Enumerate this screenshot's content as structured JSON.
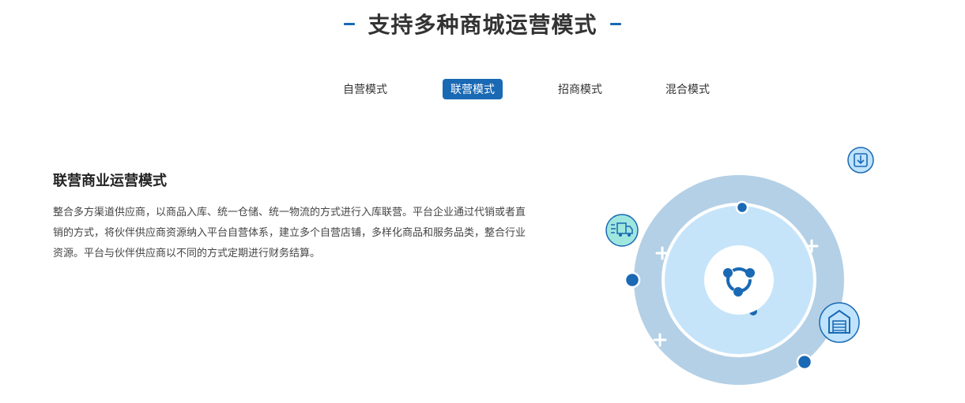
{
  "header": {
    "title": "支持多种商城运营模式"
  },
  "tabs": [
    {
      "label": "自营模式",
      "active": false
    },
    {
      "label": "联营模式",
      "active": true
    },
    {
      "label": "招商模式",
      "active": false
    },
    {
      "label": "混合模式",
      "active": false
    }
  ],
  "content": {
    "heading": "联营商业运营模式",
    "description": "整合多方渠道供应商，以商品入库、统一仓储、统一物流的方式进行入库联营。平台企业通过代销或者直销的方式，将伙伴供应商资源纳入平台自营体系，建立多个自营店铺，多样化商品和服务品类，整合行业资源。平台与伙伴供应商以不同的方式定期进行财务结算。"
  },
  "illustration": {
    "icons": [
      "download-icon",
      "delivery-truck-icon",
      "warehouse-icon",
      "network-icon"
    ],
    "colors": {
      "accent": "#1a69b4",
      "outer_ring": "#b4d0e6",
      "inner_circle": "#c5e4fa",
      "teal": "#9fe6df",
      "light_blue": "#bfe3fc"
    }
  }
}
